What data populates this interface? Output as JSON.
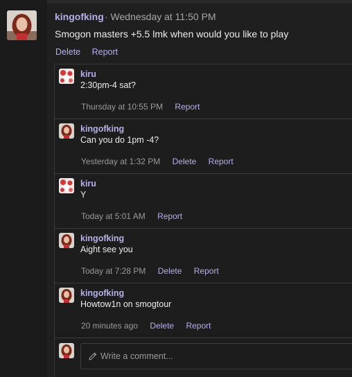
{
  "post": {
    "author": "kingofking",
    "time": "· Wednesday at 11:50 PM",
    "body": "Smogon masters +5.5 lmk when would you like to play",
    "actions": [
      "Delete",
      "Report"
    ]
  },
  "comments": [
    {
      "author": "kiru",
      "text": "2:30pm-4 sat?",
      "time": "Thursday at 10:55 PM",
      "actions": [
        "Report"
      ],
      "avatar": "kiru-avatar"
    },
    {
      "author": "kingofking",
      "text": "Can you do 1pm -4?",
      "time": "Yesterday at 1:32 PM",
      "actions": [
        "Delete",
        "Report"
      ],
      "avatar": "kingofking-avatar"
    },
    {
      "author": "kiru",
      "text": "Y",
      "time": "Today at 5:01 AM",
      "actions": [
        "Report"
      ],
      "avatar": "kiru-avatar"
    },
    {
      "author": "kingofking",
      "text": "Aight see you",
      "time": "Today at 7:28 PM",
      "actions": [
        "Delete",
        "Report"
      ],
      "avatar": "kingofking-avatar"
    },
    {
      "author": "kingofking",
      "text": "Howtow1n on smogtour",
      "time": "20 minutes ago",
      "actions": [
        "Delete",
        "Report"
      ],
      "avatar": "kingofking-avatar"
    }
  ],
  "compose": {
    "placeholder": "Write a comment...",
    "icon": "pencil-icon"
  },
  "colors": {
    "accent": "#b5b0e8",
    "background": "#1f1f1f",
    "border": "#3a3a3a",
    "muted": "#9a9a9a"
  }
}
